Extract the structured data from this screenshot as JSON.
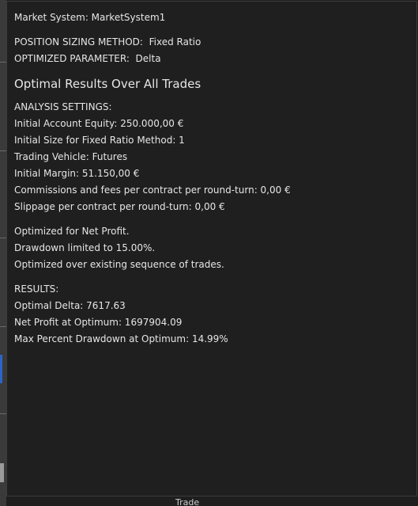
{
  "window": {
    "market_system_label": "Market System: MarketSystem1"
  },
  "method": {
    "sizing_label": "POSITION SIZING METHOD:",
    "sizing_value": "Fixed Ratio",
    "param_label": "OPTIMIZED PARAMETER:",
    "param_value": "Delta"
  },
  "report": {
    "title": "Optimal Results Over All Trades"
  },
  "analysis": {
    "heading": "ANALYSIS SETTINGS:",
    "lines": [
      "Initial Account Equity: 250.000,00 €",
      "Initial Size for Fixed Ratio Method: 1",
      "Trading Vehicle: Futures",
      "Initial Margin: 51.150,00 €",
      "Commissions and fees per contract per round-turn: 0,00 €",
      "Slippage per contract per round-turn: 0,00 €"
    ]
  },
  "optimization": {
    "lines": [
      "Optimized for Net Profit.",
      "Drawdown limited to 15.00%.",
      "Optimized over existing sequence of trades."
    ]
  },
  "results": {
    "heading": "RESULTS:",
    "lines": [
      "Optimal Delta: 7617.63",
      "Net Profit at Optimum: 1697904.09",
      "Max Percent Drawdown at Optimum: 14.99%"
    ]
  },
  "background": {
    "bottom_text": "Trade"
  },
  "colors": {
    "panel_bg": "#1f1f1f",
    "text": "#e6e6e6",
    "accent_blue": "#2d64c8"
  }
}
